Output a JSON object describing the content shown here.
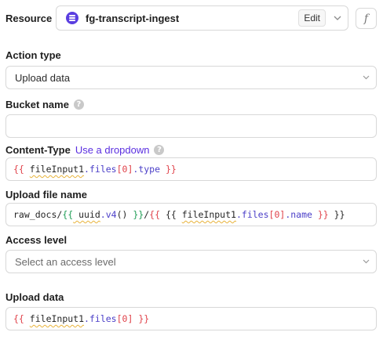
{
  "resource": {
    "label": "Resource",
    "name": "fg-transcript-ingest",
    "edit_label": "Edit",
    "fx_label": "f"
  },
  "action_type": {
    "label": "Action type",
    "value": "Upload data"
  },
  "bucket_name": {
    "label": "Bucket name",
    "help": "?",
    "value": ""
  },
  "content_type": {
    "label": "Content-Type",
    "link": "Use a dropdown",
    "help": "?",
    "code": {
      "open": "{{",
      "ident": "fileInput1",
      "prop": ".files",
      "idx_open": "[",
      "idx": "0",
      "idx_close": "]",
      "prop2": ".type",
      "close": "}}"
    }
  },
  "upload_file_name": {
    "label": "Upload file name",
    "code": {
      "prefix": "raw_docs/",
      "open1": "{{",
      "fn_obj": " uuid",
      "fn_name": ".v4",
      "fn_call": "() ",
      "close1": "}}",
      "slash": "/",
      "open2": "{{",
      "inner_open": " {{ ",
      "ident": "fileInput1",
      "prop": ".files",
      "idx_open": "[",
      "idx": "0",
      "idx_close": "]",
      "prop2": ".name",
      "inner_close": " }}",
      "close2": " }}"
    }
  },
  "access_level": {
    "label": "Access level",
    "placeholder": "Select an access level"
  },
  "upload_data": {
    "label": "Upload data",
    "code": {
      "open": "{{",
      "ident": "fileInput1",
      "prop": ".files",
      "idx_open": "[",
      "idx": "0",
      "idx_close": "]",
      "close": "}}"
    }
  }
}
